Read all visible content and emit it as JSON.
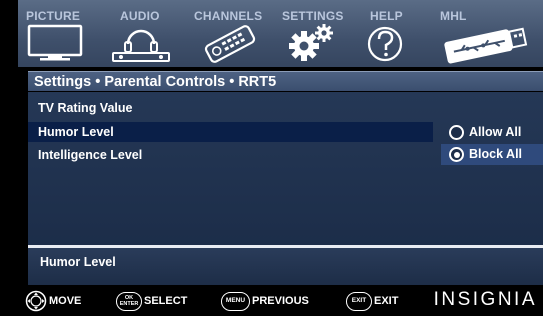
{
  "tabs": [
    {
      "label": "PICTURE",
      "icon": "tv-icon",
      "active": false
    },
    {
      "label": "AUDIO",
      "icon": "headphones-icon",
      "active": false
    },
    {
      "label": "CHANNELS",
      "icon": "remote-icon",
      "active": false
    },
    {
      "label": "SETTINGS",
      "icon": "gears-icon",
      "active": true
    },
    {
      "label": "HELP",
      "icon": "question-icon",
      "active": false
    },
    {
      "label": "MHL",
      "icon": "usb-stick-icon",
      "active": false
    }
  ],
  "breadcrumb": "Settings • Parental Controls  • RRT5",
  "menu": {
    "items": [
      {
        "label": "TV Rating Value",
        "selected": false
      },
      {
        "label": "Humor Level",
        "selected": true
      },
      {
        "label": "Intelligence Level",
        "selected": false
      }
    ],
    "options": [
      {
        "label": "Allow All",
        "checked": false
      },
      {
        "label": "Block All",
        "checked": true
      }
    ]
  },
  "help_text": "Humor Level",
  "hints": [
    {
      "button": "",
      "label": "MOVE"
    },
    {
      "button": "OK ENTER",
      "label": "SELECT"
    },
    {
      "button": "MENU",
      "label": "PREVIOUS"
    },
    {
      "button": "EXIT",
      "label": "EXIT"
    }
  ],
  "brand": "INSIGNIA",
  "colors": {
    "accent": "#0a1f48",
    "panel": "#1c2d49",
    "tabbar": "#3f506b"
  }
}
